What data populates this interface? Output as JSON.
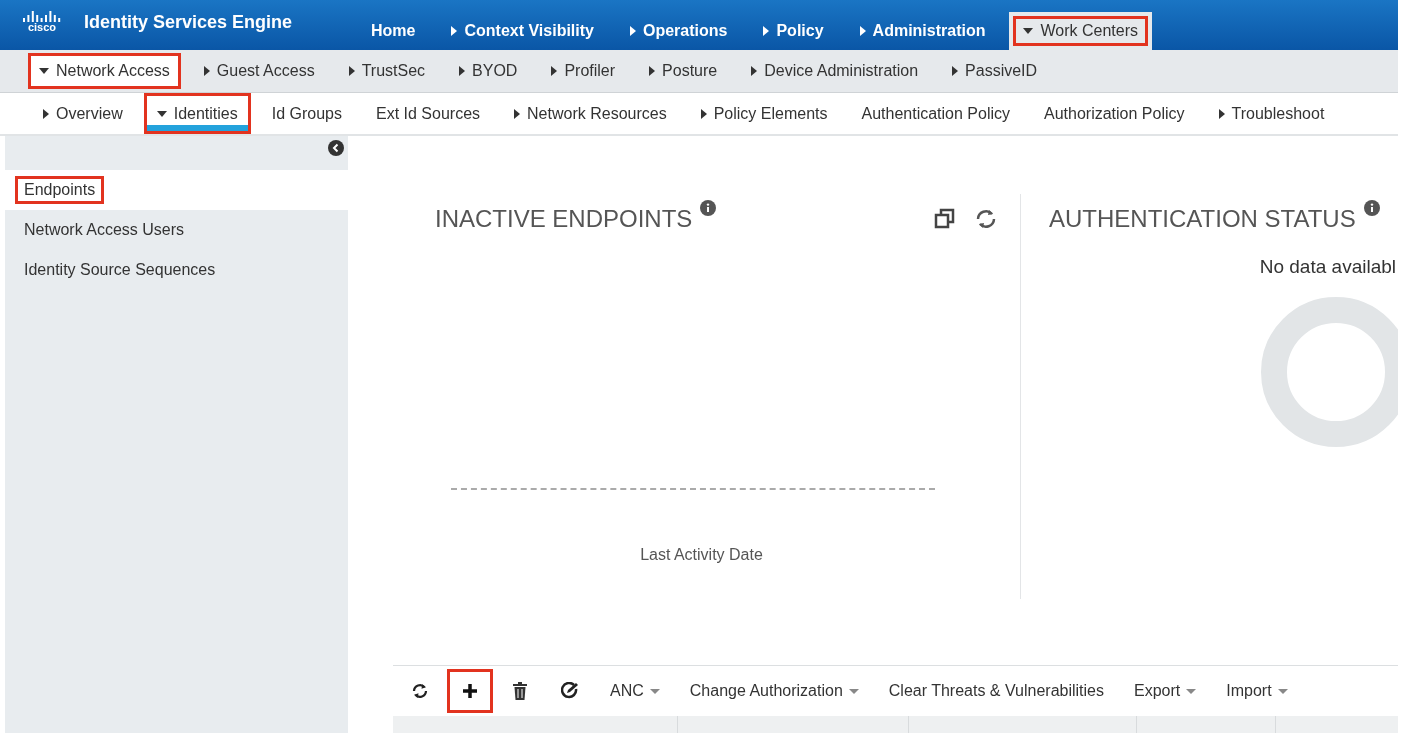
{
  "header": {
    "logo_text": "cisco",
    "product": "Identity Services Engine",
    "tabs": [
      {
        "label": "Home",
        "selected": false,
        "highlighted": false
      },
      {
        "label": "Context Visibility",
        "expanded": false,
        "selected": false,
        "highlighted": false
      },
      {
        "label": "Operations",
        "expanded": false,
        "selected": false,
        "highlighted": false
      },
      {
        "label": "Policy",
        "expanded": false,
        "selected": false,
        "highlighted": false
      },
      {
        "label": "Administration",
        "expanded": false,
        "selected": false,
        "highlighted": false
      },
      {
        "label": "Work Centers",
        "expanded": true,
        "selected": true,
        "highlighted": true
      }
    ]
  },
  "subnav": [
    {
      "label": "Network Access",
      "expanded": true,
      "selected": true,
      "highlighted": true
    },
    {
      "label": "Guest Access",
      "expanded": false,
      "selected": false,
      "highlighted": false
    },
    {
      "label": "TrustSec",
      "expanded": false,
      "selected": false,
      "highlighted": false
    },
    {
      "label": "BYOD",
      "expanded": false,
      "selected": false,
      "highlighted": false
    },
    {
      "label": "Profiler",
      "expanded": false,
      "selected": false,
      "highlighted": false
    },
    {
      "label": "Posture",
      "expanded": false,
      "selected": false,
      "highlighted": false
    },
    {
      "label": "Device Administration",
      "expanded": false,
      "selected": false,
      "highlighted": false
    },
    {
      "label": "PassiveID",
      "expanded": false,
      "selected": false,
      "highlighted": false
    }
  ],
  "tertiary_nav": [
    {
      "label": "Overview",
      "expanded": false,
      "selected": false,
      "highlighted": false
    },
    {
      "label": "Identities",
      "expanded": true,
      "selected": true,
      "highlighted": true
    },
    {
      "label": "Id Groups",
      "selected": false,
      "highlighted": false
    },
    {
      "label": "Ext Id Sources",
      "selected": false,
      "highlighted": false
    },
    {
      "label": "Network Resources",
      "expanded": false,
      "selected": false,
      "highlighted": false
    },
    {
      "label": "Policy Elements",
      "expanded": false,
      "selected": false,
      "highlighted": false
    },
    {
      "label": "Authentication Policy",
      "selected": false,
      "highlighted": false
    },
    {
      "label": "Authorization Policy",
      "selected": false,
      "highlighted": false
    },
    {
      "label": "Troubleshoot",
      "expanded": false,
      "selected": false,
      "highlighted": false
    }
  ],
  "sidebar": {
    "items": [
      {
        "label": "Endpoints",
        "selected": true,
        "highlighted": true
      },
      {
        "label": "Network Access Users",
        "selected": false,
        "highlighted": false
      },
      {
        "label": "Identity Source Sequences",
        "selected": false,
        "highlighted": false
      }
    ]
  },
  "dashlets": [
    {
      "kind": "chart",
      "title": "INACTIVE ENDPOINTS",
      "axis_label": "Last Activity Date"
    },
    {
      "kind": "donut",
      "title": "AUTHENTICATION STATUS",
      "message": "No data availabl"
    }
  ],
  "toolbar": [
    {
      "kind": "refresh",
      "highlighted": false
    },
    {
      "kind": "add",
      "highlighted": true
    },
    {
      "kind": "delete",
      "highlighted": false
    },
    {
      "kind": "edit",
      "highlighted": false
    },
    {
      "kind": "dropdown",
      "label": "ANC",
      "highlighted": false
    },
    {
      "kind": "dropdown",
      "label": "Change Authorization",
      "highlighted": false
    },
    {
      "kind": "button",
      "label": "Clear Threats & Vulnerabilities",
      "highlighted": false
    },
    {
      "kind": "dropdown",
      "label": "Export",
      "highlighted": false
    },
    {
      "kind": "dropdown",
      "label": "Import",
      "highlighted": false
    }
  ]
}
